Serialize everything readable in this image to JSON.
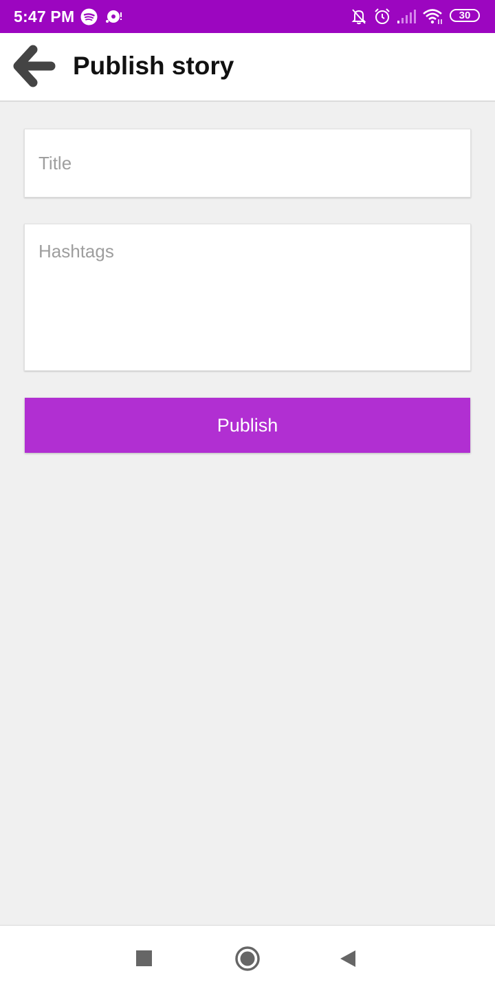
{
  "status_bar": {
    "time": "5:47 PM",
    "battery": "30",
    "left_icons": [
      "spotify-icon",
      "media-icon"
    ],
    "right_icons": [
      "notifications-off-icon",
      "alarm-icon",
      "signal-icon",
      "wifi-icon",
      "battery-icon"
    ],
    "background": "#9c06c0"
  },
  "app_bar": {
    "title": "Publish story",
    "back_icon": "arrow-left-icon"
  },
  "form": {
    "title_placeholder": "Title",
    "title_value": "",
    "hashtags_placeholder": "Hashtags",
    "hashtags_value": "",
    "publish_label": "Publish",
    "accent": "#b12fd2"
  },
  "nav_bar": {
    "buttons": [
      "recents-icon",
      "home-icon",
      "back-icon"
    ]
  }
}
